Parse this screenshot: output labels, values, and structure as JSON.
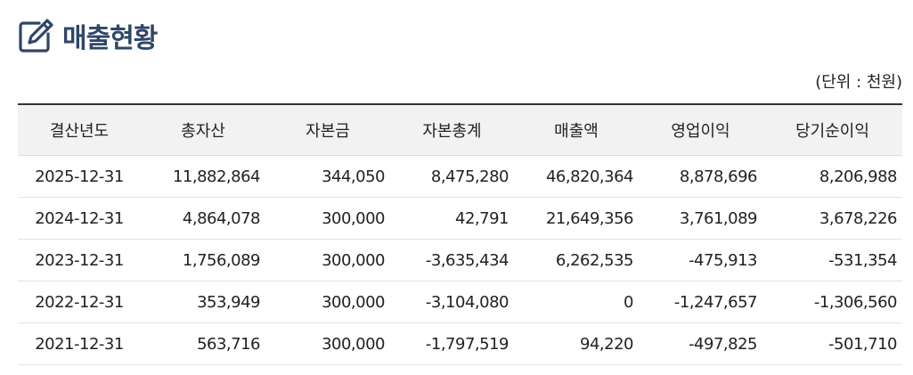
{
  "page": {
    "title": "매출현황",
    "unit_label": "(단위 : 천원)"
  },
  "table": {
    "headers": [
      "결산년도",
      "총자산",
      "자본금",
      "자본총계",
      "매출액",
      "영업이익",
      "당기순이익"
    ],
    "rows": [
      [
        "2025-12-31",
        "11,882,864",
        "344,050",
        "8,475,280",
        "46,820,364",
        "8,878,696",
        "8,206,988"
      ],
      [
        "2024-12-31",
        "4,864,078",
        "300,000",
        "42,791",
        "21,649,356",
        "3,761,089",
        "3,678,226"
      ],
      [
        "2023-12-31",
        "1,756,089",
        "300,000",
        "-3,635,434",
        "6,262,535",
        "-475,913",
        "-531,354"
      ],
      [
        "2022-12-31",
        "353,949",
        "300,000",
        "-3,104,080",
        "0",
        "-1,247,657",
        "-1,306,560"
      ],
      [
        "2021-12-31",
        "563,716",
        "300,000",
        "-1,797,519",
        "94,220",
        "-497,825",
        "-501,710"
      ]
    ]
  },
  "icons": {
    "title_icon": "edit-icon"
  },
  "colors": {
    "title": "#2f4668",
    "header_bg": "#f2f2f2"
  }
}
